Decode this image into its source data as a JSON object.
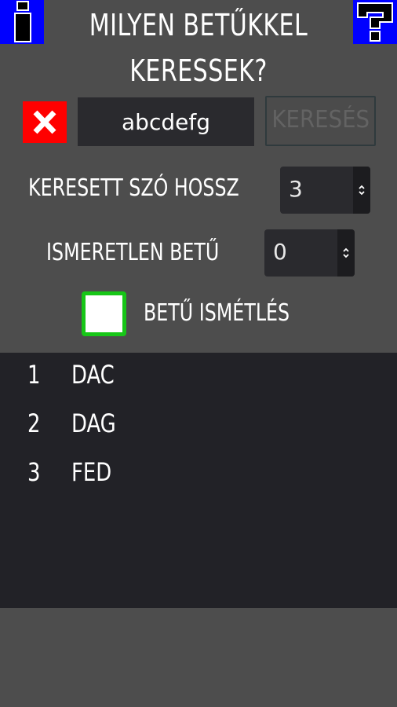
{
  "header": {
    "title_line1": "MILYEN BETŰKKEL",
    "title_line2": "KERESSEK?",
    "info_icon": "info-icon",
    "help_icon": "help-icon"
  },
  "search": {
    "clear_icon": "close-icon",
    "input_value": "abcdefg",
    "button_label": "KERESÉS"
  },
  "options": {
    "length_label": "KERESETT SZÓ HOSSZ",
    "length_value": "3",
    "unknown_label": "ISMERETLEN BETŰ",
    "unknown_value": "0",
    "repeat_label": "BETŰ ISMÉTLÉS",
    "repeat_checked": false
  },
  "results": [
    {
      "num": "1",
      "word": "DAC"
    },
    {
      "num": "2",
      "word": "DAG"
    },
    {
      "num": "3",
      "word": "FED"
    }
  ],
  "colors": {
    "background": "#4d4d4d",
    "corner_button": "#0000ff",
    "clear_button": "#ff0000",
    "checkbox_border": "#17c617",
    "results_background": "#222227"
  }
}
